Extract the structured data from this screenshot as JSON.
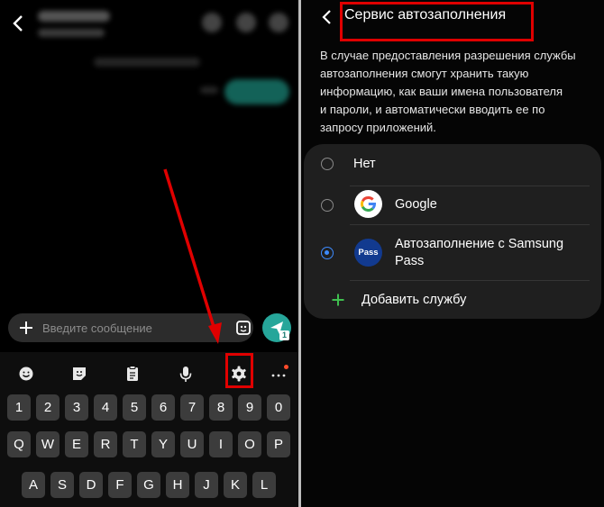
{
  "left_screen": {
    "composer": {
      "placeholder": "Введите сообщение",
      "sim_badge": "1"
    },
    "keyboard": {
      "toolbar": [
        "emoji-icon",
        "sticker-icon",
        "clipboard-icon",
        "microphone-icon",
        "settings-gear-icon",
        "more-icon"
      ],
      "rows": [
        [
          "1",
          "2",
          "3",
          "4",
          "5",
          "6",
          "7",
          "8",
          "9",
          "0"
        ],
        [
          "Q",
          "W",
          "E",
          "R",
          "T",
          "Y",
          "U",
          "I",
          "O",
          "P"
        ],
        [
          "A",
          "S",
          "D",
          "F",
          "G",
          "H",
          "J",
          "K",
          "L"
        ]
      ]
    },
    "annotation_color": "#e00000"
  },
  "right_screen": {
    "title": "Сервис автозаполнения",
    "description_lines": [
      "В случае предоставления разрешения службы",
      "автозаполнения смогут хранить такую",
      "информацию, как ваши имена пользователя",
      "и пароли, и автоматически вводить ее по",
      "запросу приложений."
    ],
    "options": [
      {
        "label": "Нет",
        "selected": false
      },
      {
        "label": "Google",
        "selected": false,
        "icon": "google-logo"
      },
      {
        "label_lines": [
          "Автозаполнение с Samsung",
          "Pass"
        ],
        "selected": true,
        "icon": "samsung-pass-logo",
        "icon_text": "Pass"
      }
    ],
    "add_service_label": "Добавить службу",
    "accent_color": "#3d8bff",
    "add_icon_color": "#3fbf4f"
  }
}
